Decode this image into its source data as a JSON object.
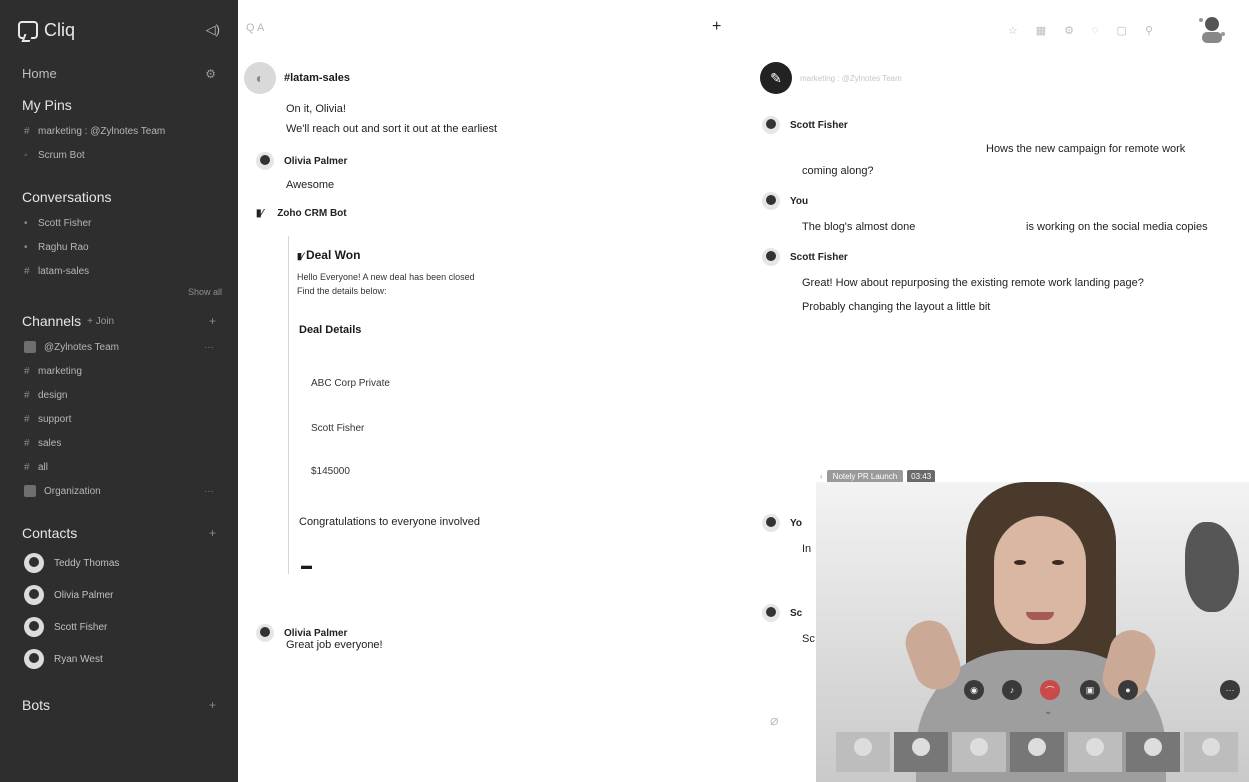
{
  "app": {
    "name": "Cliq"
  },
  "sidebar": {
    "home": "Home",
    "pins_heading": "My Pins",
    "pins": [
      "marketing : @Zylnotes Team",
      "Scrum Bot"
    ],
    "conversations_heading": "Conversations",
    "conversations": [
      "Scott Fisher",
      "Raghu Rao",
      "latam-sales"
    ],
    "show_all": "Show all",
    "channels_heading": "Channels",
    "channels_join": "+ Join",
    "channels": [
      "@Zylnotes Team",
      "marketing",
      "design",
      "support",
      "sales",
      "all",
      "Organization"
    ],
    "contacts_heading": "Contacts",
    "contacts": [
      "Teddy Thomas",
      "Olivia Palmer",
      "Scott Fisher",
      "Ryan West"
    ],
    "bots_heading": "Bots"
  },
  "topbar": {
    "search_placeholder": "A",
    "add": "+"
  },
  "left_chat": {
    "title": "#latam-sales",
    "messages": [
      {
        "text": "On it, Olivia!"
      },
      {
        "text": "We'll reach out and sort it out at the earliest"
      }
    ],
    "olivia1": {
      "author": "Olivia Palmer",
      "text": "Awesome"
    },
    "bot": {
      "author": "Zoho CRM Bot"
    },
    "card": {
      "title": "Deal Won",
      "line1": "Hello Everyone! A new deal has been closed",
      "line2": "Find the details below:",
      "details_heading": "Deal Details",
      "company": "ABC Corp Private",
      "owner": "Scott Fisher",
      "amount": "$145000",
      "footer": "Congratulations to everyone involved"
    },
    "olivia2": {
      "author": "Olivia Palmer",
      "text": "Great job everyone!"
    }
  },
  "right_chat": {
    "title": "marketing : @Zylnotes Team",
    "m1": {
      "author": "Scott Fisher",
      "text": "Hows the new campaign for remote work",
      "text2": "coming along?"
    },
    "m2": {
      "author": "You",
      "text_a": "The blog's almost done",
      "text_b": "is working on the social media copies"
    },
    "m3": {
      "author": "Scott Fisher",
      "text1": "Great! How about repurposing the existing remote work landing page?",
      "text2": "Probably changing the layout a little bit"
    },
    "m4": {
      "author": "Yo",
      "text": "In"
    },
    "m5": {
      "author": "Sc",
      "text": "Sc"
    },
    "pr_tag": "Notely PR Launch",
    "pr_time": "03:43"
  }
}
